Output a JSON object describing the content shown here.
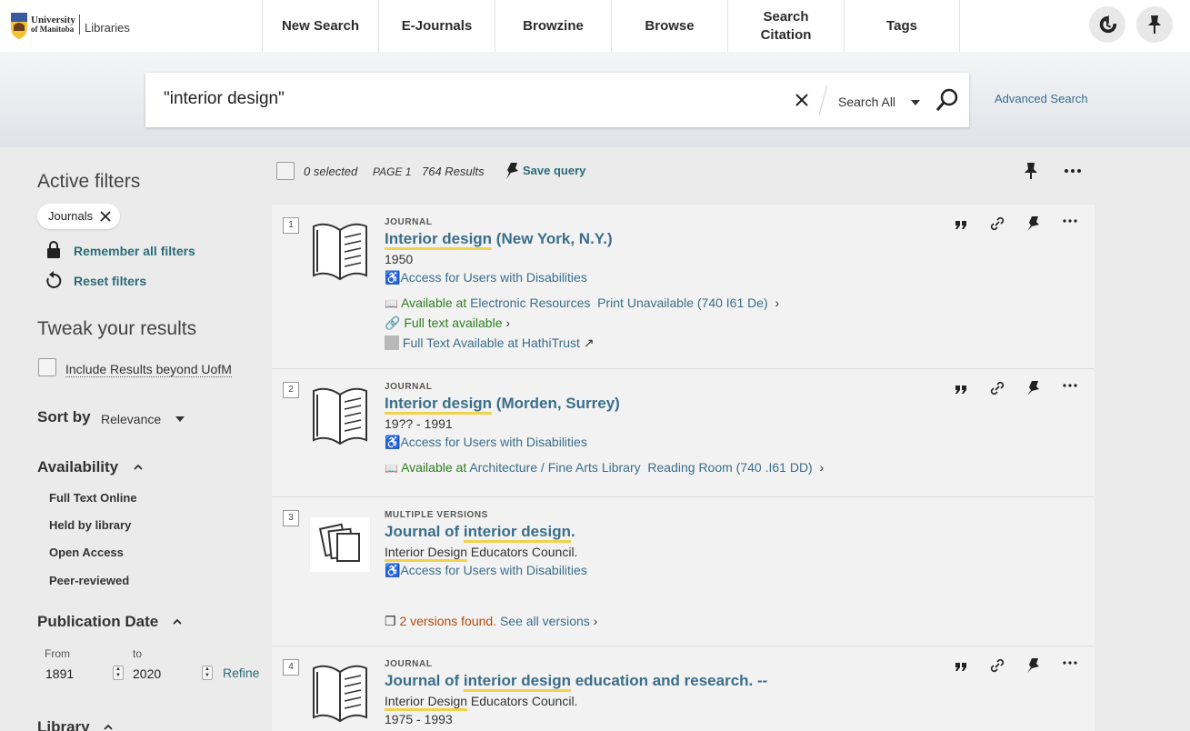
{
  "header": {
    "logo_univ_line1": "University",
    "logo_univ_line2": "of Manitoba",
    "logo_lib": "Libraries",
    "nav": [
      {
        "label": "New Search"
      },
      {
        "label": "E-Journals"
      },
      {
        "label": "Browzine"
      },
      {
        "label": "Browse"
      },
      {
        "label": "Search\nCitation"
      },
      {
        "label": "Tags"
      }
    ]
  },
  "search": {
    "query": "\"interior design\"",
    "scope": "Search All",
    "advanced": "Advanced Search"
  },
  "sidebar": {
    "active_filters_title": "Active filters",
    "chip": "Journals",
    "remember": "Remember all filters",
    "reset": "Reset filters",
    "tweak_title": "Tweak your results",
    "include_beyond": "Include Results beyond UofM",
    "sort_label": "Sort by",
    "sort_value": "Relevance",
    "availability_title": "Availability",
    "facets": [
      "Full Text Online",
      "Held by library",
      "Open Access",
      "Peer-reviewed"
    ],
    "pubdate_title": "Publication Date",
    "from_label": "From",
    "to_label": "to",
    "from_value": "1891",
    "to_value": "2020",
    "refine": "Refine",
    "library_title": "Library"
  },
  "results_bar": {
    "selected": "0 selected",
    "page": "PAGE 1",
    "count": "764 Results",
    "save_query": "Save query"
  },
  "results": [
    {
      "num": "1",
      "type": "JOURNAL",
      "title_hl": "Interior design",
      "title_rest": " (New York, N.Y.)",
      "line1": "1950",
      "access": "Access for Users with Disabilities",
      "avail_prefix": "Available at ",
      "avail_loc": "Electronic Resources",
      "avail_extra": "Print Unavailable (740 I61 De)",
      "fulltext": "Full text available",
      "hathi": "Full Text Available at HathiTrust"
    },
    {
      "num": "2",
      "type": "JOURNAL",
      "title_hl": "Interior design",
      "title_rest": " (Morden, Surrey)",
      "line1": "19?? - 1991",
      "access": "Access for Users with Disabilities",
      "avail_prefix": "Available at ",
      "avail_loc": "Architecture / Fine Arts Library",
      "avail_extra": "Reading Room (740 .I61 DD)"
    },
    {
      "num": "3",
      "type": "MULTIPLE VERSIONS",
      "title_pre": "Journal of ",
      "title_hl": "interior design",
      "title_rest": ".",
      "line1_hl": "Interior Design",
      "line1_rest": " Educators Council.",
      "access": "Access for Users with Disabilities",
      "versions": "2 versions found.",
      "see_all": "See all versions"
    },
    {
      "num": "4",
      "type": "JOURNAL",
      "title_pre": "Journal of ",
      "title_hl": "interior design",
      "title_rest": " education and research. --",
      "line1_hl": "Interior Design",
      "line1_rest": " Educators Council.",
      "line2": "1975 - 1993"
    }
  ]
}
